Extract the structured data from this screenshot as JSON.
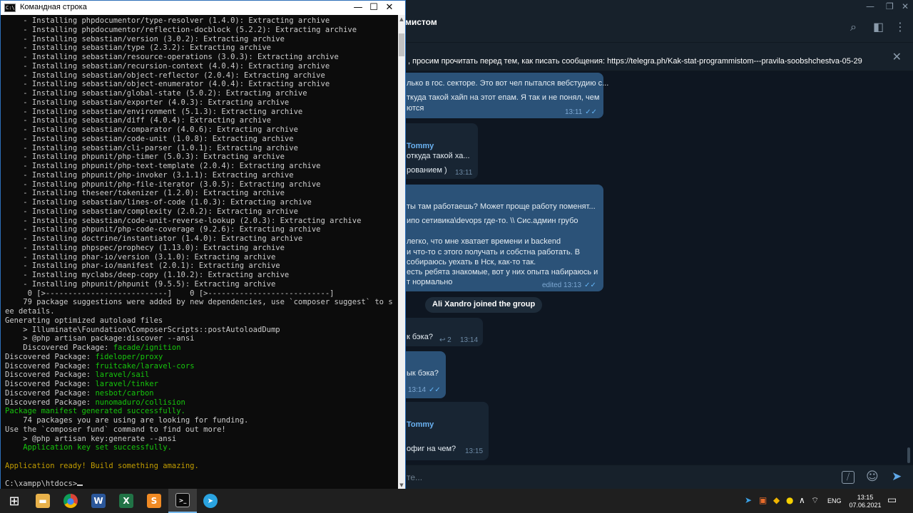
{
  "telegram": {
    "chat_title": "мистом",
    "window_controls": {
      "minimize": "—",
      "restore": "❐",
      "close": "✕"
    },
    "header_icons": {
      "search": "⌕",
      "sidebar": "◧",
      "menu": "⋮"
    },
    "pinned": {
      "text": ", просим прочитать перед тем, как писать сообщения: https://telegra.ph/Kak-stat-programmistom---pravila-soobshchestva-05-29",
      "close": "✕"
    },
    "messages": [
      {
        "lines": [
          "лько в гос. секторе. Это вот чел пытался вебстудию с...",
          "ткуда такой хайп на этот епам. Я так и не понял, чем",
          "ются"
        ],
        "time": "13:11",
        "ticks": "✓✓"
      },
      {
        "author": "Tommy",
        "lines": [
          "откуда такой ха...",
          "рованием )"
        ],
        "time": "13:11"
      },
      {
        "lines": [
          "ты там работаешь? Может проще работу поменят...",
          "ипо сетивика\\devops где-то. \\\\ Сис.админ грубо",
          "",
          "легко, что мне хватает времени и backend",
          "и что-то с этого получать и собстна работать. В",
          "собираюсь уехать в Нск, как-то так.",
          "есть ребята знакомые, вот у них опыта набираюсь и",
          "т нормально"
        ],
        "time": "edited 13:13",
        "ticks": "✓✓"
      },
      {
        "lines": [
          "к бэка?"
        ],
        "reply": "↩ 2",
        "time": "13:14"
      },
      {
        "lines": [
          "ык бэка?"
        ],
        "time": "13:14",
        "ticks": "✓✓"
      },
      {
        "author": "Tommy",
        "lines": [
          "офиг на чем?"
        ],
        "time": "13:15"
      }
    ],
    "service_message": "Ali Xandro joined the group",
    "compose": {
      "placeholder": "те...",
      "command_icon": "⧸",
      "emoji_icon": "☺",
      "send_icon": "➤"
    }
  },
  "cmd": {
    "title": "Командная строка",
    "icon_text": "C:\\",
    "window_controls": {
      "minimize": "—",
      "maximize": "☐",
      "close": "✕"
    },
    "scroll_up": "▲",
    "scroll_down": "▼",
    "lines": [
      {
        "t": "    - Installing phpdocumentor/type-resolver (1.4.0): Extracting archive"
      },
      {
        "t": "    - Installing phpdocumentor/reflection-docblock (5.2.2): Extracting archive"
      },
      {
        "t": "    - Installing sebastian/version (3.0.2): Extracting archive"
      },
      {
        "t": "    - Installing sebastian/type (2.3.2): Extracting archive"
      },
      {
        "t": "    - Installing sebastian/resource-operations (3.0.3): Extracting archive"
      },
      {
        "t": "    - Installing sebastian/recursion-context (4.0.4): Extracting archive"
      },
      {
        "t": "    - Installing sebastian/object-reflector (2.0.4): Extracting archive"
      },
      {
        "t": "    - Installing sebastian/object-enumerator (4.0.4): Extracting archive"
      },
      {
        "t": "    - Installing sebastian/global-state (5.0.2): Extracting archive"
      },
      {
        "t": "    - Installing sebastian/exporter (4.0.3): Extracting archive"
      },
      {
        "t": "    - Installing sebastian/environment (5.1.3): Extracting archive"
      },
      {
        "t": "    - Installing sebastian/diff (4.0.4): Extracting archive"
      },
      {
        "t": "    - Installing sebastian/comparator (4.0.6): Extracting archive"
      },
      {
        "t": "    - Installing sebastian/code-unit (1.0.8): Extracting archive"
      },
      {
        "t": "    - Installing sebastian/cli-parser (1.0.1): Extracting archive"
      },
      {
        "t": "    - Installing phpunit/php-timer (5.0.3): Extracting archive"
      },
      {
        "t": "    - Installing phpunit/php-text-template (2.0.4): Extracting archive"
      },
      {
        "t": "    - Installing phpunit/php-invoker (3.1.1): Extracting archive"
      },
      {
        "t": "    - Installing phpunit/php-file-iterator (3.0.5): Extracting archive"
      },
      {
        "t": "    - Installing theseer/tokenizer (1.2.0): Extracting archive"
      },
      {
        "t": "    - Installing sebastian/lines-of-code (1.0.3): Extracting archive"
      },
      {
        "t": "    - Installing sebastian/complexity (2.0.2): Extracting archive"
      },
      {
        "t": "    - Installing sebastian/code-unit-reverse-lookup (2.0.3): Extracting archive"
      },
      {
        "t": "    - Installing phpunit/php-code-coverage (9.2.6): Extracting archive"
      },
      {
        "t": "    - Installing doctrine/instantiator (1.4.0): Extracting archive"
      },
      {
        "t": "    - Installing phpspec/prophecy (1.13.0): Extracting archive"
      },
      {
        "t": "    - Installing phar-io/version (3.1.0): Extracting archive"
      },
      {
        "t": "    - Installing phar-io/manifest (2.0.1): Extracting archive"
      },
      {
        "t": "    - Installing myclabs/deep-copy (1.10.2): Extracting archive"
      },
      {
        "t": "    - Installing phpunit/phpunit (9.5.5): Extracting archive"
      },
      {
        "t": "     0 [>---------------------------]    0 [>---------------------------]"
      },
      {
        "t": "    79 package suggestions were added by new dependencies, use `composer suggest` to s"
      },
      {
        "t": "ee details."
      },
      {
        "t": "Generating optimized autoload files"
      },
      {
        "t": "    > Illuminate\\Foundation\\ComposerScripts::postAutoloadDump"
      },
      {
        "t": "    > @php artisan package:discover --ansi"
      },
      {
        "p": "    Discovered Package: ",
        "g": "facade/ignition"
      },
      {
        "p": "Discovered Package: ",
        "g": "fideloper/proxy"
      },
      {
        "p": "Discovered Package: ",
        "g": "fruitcake/laravel-cors"
      },
      {
        "p": "Discovered Package: ",
        "g": "laravel/sail"
      },
      {
        "p": "Discovered Package: ",
        "g": "laravel/tinker"
      },
      {
        "p": "Discovered Package: ",
        "g": "nesbot/carbon"
      },
      {
        "p": "Discovered Package: ",
        "g": "nunomaduro/collision"
      },
      {
        "g": "Package manifest generated successfully."
      },
      {
        "t": "    74 packages you are using are looking for funding."
      },
      {
        "t": "Use the `composer fund` command to find out more!"
      },
      {
        "t": "    > @php artisan key:generate --ansi"
      },
      {
        "g": "    Application key set successfully."
      },
      {
        "t": ""
      },
      {
        "y": "Application ready! Build something amazing."
      },
      {
        "t": ""
      },
      {
        "t": "C:\\xampp\\htdocs>",
        "cursor": true
      }
    ]
  },
  "taskbar": {
    "apps": [
      {
        "name": "start",
        "glyph": "⊞",
        "color": "transparent",
        "active": false
      },
      {
        "name": "explorer",
        "glyph": "▬",
        "color": "#e8b14a",
        "active": false
      },
      {
        "name": "chrome",
        "glyph": "●",
        "color": "#2b7de9",
        "active": false
      },
      {
        "name": "word",
        "glyph": "W",
        "color": "#2b579a",
        "active": false
      },
      {
        "name": "excel",
        "glyph": "X",
        "color": "#217346",
        "active": false
      },
      {
        "name": "sublime",
        "glyph": "S",
        "color": "#f08a24",
        "active": false
      },
      {
        "name": "cmd",
        "glyph": ">_",
        "color": "#0c0c0c",
        "active": true
      },
      {
        "name": "telegram",
        "glyph": "➤",
        "color": "#2aa3e0",
        "active": false
      }
    ],
    "tray": {
      "chevron": "∧",
      "wifi": "⌔",
      "volume": "🔈︎",
      "notify": "▭"
    },
    "lang": "ENG",
    "time": "13:15",
    "date": "07.06.2021"
  }
}
